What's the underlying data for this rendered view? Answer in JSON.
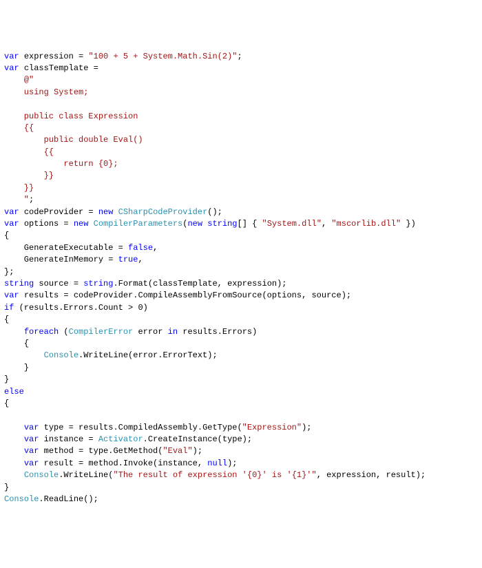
{
  "tokens": [
    {
      "t": "var ",
      "c": "kw"
    },
    {
      "t": "expression = "
    },
    {
      "t": "\"100 + 5 + System.Math.Sin(2)\"",
      "c": "str"
    },
    {
      "t": ";\n"
    },
    {
      "t": "var ",
      "c": "kw"
    },
    {
      "t": "classTemplate =\n"
    },
    {
      "t": "    "
    },
    {
      "t": "@\"",
      "c": "str"
    },
    {
      "t": "\n"
    },
    {
      "t": "    using System;",
      "c": "str"
    },
    {
      "t": "\n\n"
    },
    {
      "t": "    public class Expression",
      "c": "str"
    },
    {
      "t": "\n"
    },
    {
      "t": "    {{",
      "c": "str"
    },
    {
      "t": "\n"
    },
    {
      "t": "        public double Eval()",
      "c": "str"
    },
    {
      "t": "\n"
    },
    {
      "t": "        {{",
      "c": "str"
    },
    {
      "t": "\n"
    },
    {
      "t": "            return {0};",
      "c": "str"
    },
    {
      "t": "\n"
    },
    {
      "t": "        }}",
      "c": "str"
    },
    {
      "t": "\n"
    },
    {
      "t": "    }}",
      "c": "str"
    },
    {
      "t": "\n"
    },
    {
      "t": "    \"",
      "c": "str"
    },
    {
      "t": ";\n"
    },
    {
      "t": "var ",
      "c": "kw"
    },
    {
      "t": "codeProvider = "
    },
    {
      "t": "new ",
      "c": "kw"
    },
    {
      "t": "CSharpCodeProvider",
      "c": "type"
    },
    {
      "t": "();\n"
    },
    {
      "t": "var ",
      "c": "kw"
    },
    {
      "t": "options = "
    },
    {
      "t": "new ",
      "c": "kw"
    },
    {
      "t": "CompilerParameters",
      "c": "type"
    },
    {
      "t": "("
    },
    {
      "t": "new ",
      "c": "kw"
    },
    {
      "t": "string",
      "c": "kw"
    },
    {
      "t": "[] { "
    },
    {
      "t": "\"System.dll\"",
      "c": "str"
    },
    {
      "t": ", "
    },
    {
      "t": "\"mscorlib.dll\"",
      "c": "str"
    },
    {
      "t": " })\n"
    },
    {
      "t": "{\n"
    },
    {
      "t": "    GenerateExecutable = "
    },
    {
      "t": "false",
      "c": "kw"
    },
    {
      "t": ",\n"
    },
    {
      "t": "    GenerateInMemory = "
    },
    {
      "t": "true",
      "c": "kw"
    },
    {
      "t": ",\n"
    },
    {
      "t": "};\n"
    },
    {
      "t": "string ",
      "c": "kw"
    },
    {
      "t": "source = "
    },
    {
      "t": "string",
      "c": "kw"
    },
    {
      "t": ".Format(classTemplate, expression);\n"
    },
    {
      "t": "var ",
      "c": "kw"
    },
    {
      "t": "results = codeProvider.CompileAssemblyFromSource(options, source);\n"
    },
    {
      "t": "if ",
      "c": "kw"
    },
    {
      "t": "(results.Errors.Count > 0)\n"
    },
    {
      "t": "{\n"
    },
    {
      "t": "    "
    },
    {
      "t": "foreach ",
      "c": "kw"
    },
    {
      "t": "("
    },
    {
      "t": "CompilerError",
      "c": "type"
    },
    {
      "t": " error "
    },
    {
      "t": "in ",
      "c": "kw"
    },
    {
      "t": "results.Errors)\n"
    },
    {
      "t": "    {\n"
    },
    {
      "t": "        "
    },
    {
      "t": "Console",
      "c": "type"
    },
    {
      "t": ".WriteLine(error.ErrorText);\n"
    },
    {
      "t": "    }\n"
    },
    {
      "t": "}\n"
    },
    {
      "t": "else",
      "c": "kw"
    },
    {
      "t": "\n"
    },
    {
      "t": "{\n"
    },
    {
      "t": "\n"
    },
    {
      "t": "    "
    },
    {
      "t": "var ",
      "c": "kw"
    },
    {
      "t": "type = results.CompiledAssembly.GetType("
    },
    {
      "t": "\"Expression\"",
      "c": "str"
    },
    {
      "t": ");\n"
    },
    {
      "t": "    "
    },
    {
      "t": "var ",
      "c": "kw"
    },
    {
      "t": "instance = "
    },
    {
      "t": "Activator",
      "c": "type"
    },
    {
      "t": ".CreateInstance(type);\n"
    },
    {
      "t": "    "
    },
    {
      "t": "var ",
      "c": "kw"
    },
    {
      "t": "method = type.GetMethod("
    },
    {
      "t": "\"Eval\"",
      "c": "str"
    },
    {
      "t": ");\n"
    },
    {
      "t": "    "
    },
    {
      "t": "var ",
      "c": "kw"
    },
    {
      "t": "result = method.Invoke(instance, "
    },
    {
      "t": "null",
      "c": "kw"
    },
    {
      "t": ");\n"
    },
    {
      "t": "    "
    },
    {
      "t": "Console",
      "c": "type"
    },
    {
      "t": ".WriteLine("
    },
    {
      "t": "\"The result of expression '{0}' is '{1}'\"",
      "c": "str"
    },
    {
      "t": ", expression, result);\n"
    },
    {
      "t": "}\n"
    },
    {
      "t": "Console",
      "c": "type"
    },
    {
      "t": ".ReadLine();\n"
    }
  ]
}
